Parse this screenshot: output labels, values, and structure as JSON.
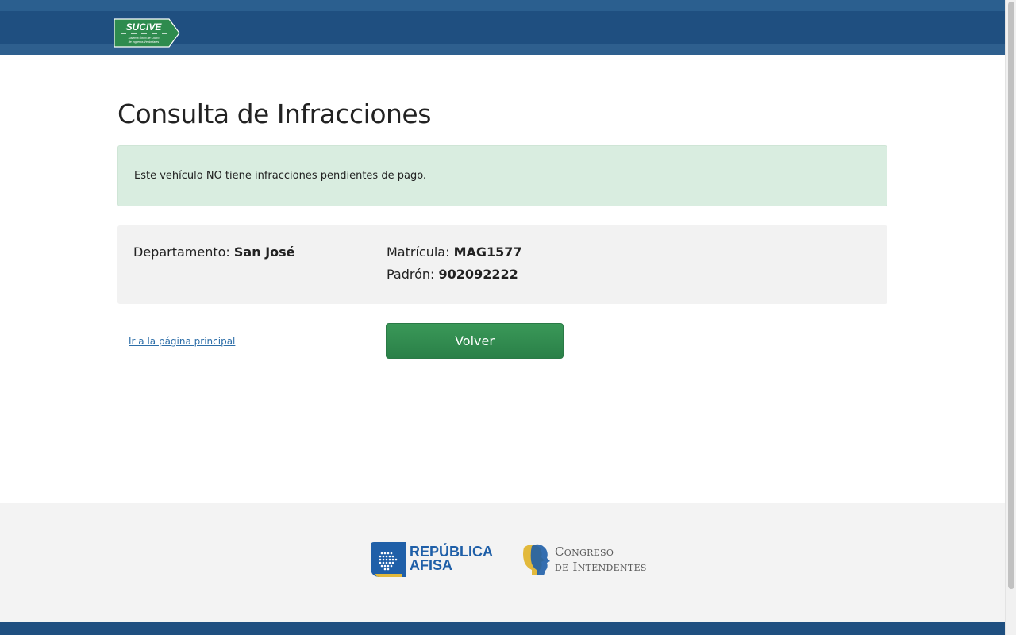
{
  "header": {
    "logo_text": "SUCIVE",
    "logo_subtext": "Sistema Único de Cobro de Ingresos Vehiculares"
  },
  "page": {
    "title": "Consulta de Infracciones"
  },
  "alert": {
    "message": "Este vehículo NO tiene infracciones pendientes de pago."
  },
  "vehicle": {
    "departamento_label": "Departamento:",
    "departamento_value": "San José",
    "matricula_label": "Matrícula:",
    "matricula_value": "MAG1577",
    "padron_label": "Padrón:",
    "padron_value": "902092222"
  },
  "actions": {
    "home_link": "Ir a la página principal",
    "back_button": "Volver"
  },
  "footer": {
    "afisa_line1": "REPÚBLICA",
    "afisa_line2": "AFISA",
    "congreso_line1": "Congreso",
    "congreso_line2": "de Intendentes"
  },
  "colors": {
    "header_blue": "#1f4f80",
    "brand_green": "#2e8b4e",
    "alert_green": "#d9ede0",
    "link_blue": "#2d6ea8"
  }
}
